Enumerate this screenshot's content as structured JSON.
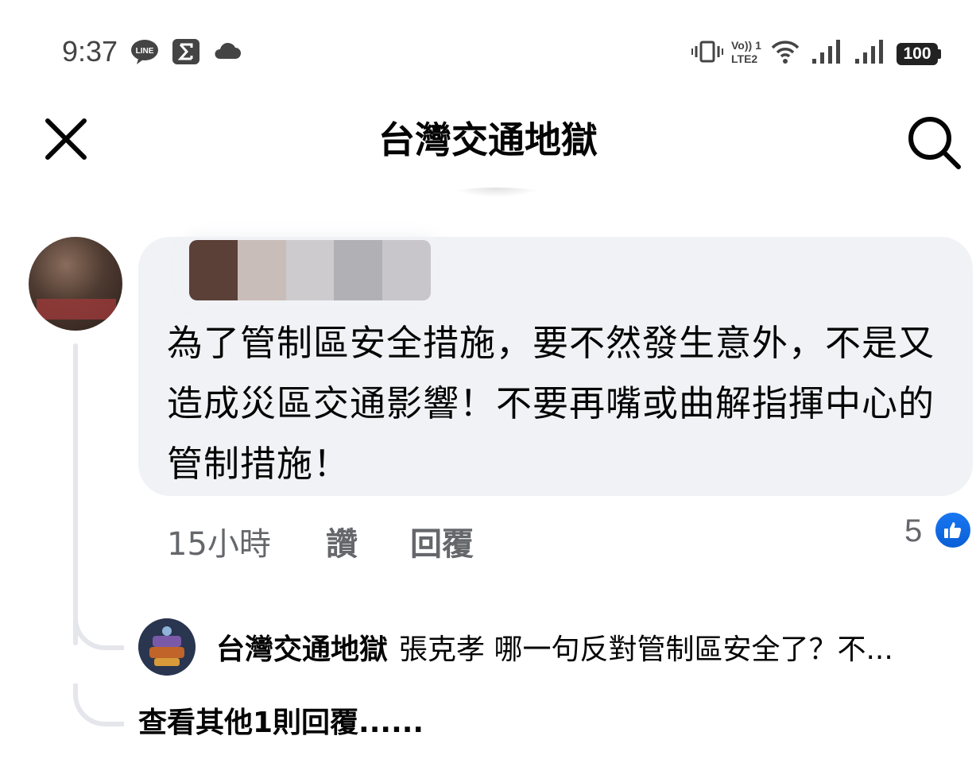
{
  "status_bar": {
    "time": "9:37",
    "left_icons": [
      "line-icon",
      "sigma-icon",
      "cloud-icon"
    ],
    "right_icons": [
      "vibrate-icon",
      "volte-lte2-icon",
      "wifi-icon",
      "signal-icon",
      "signal-icon"
    ],
    "volte_label": "Vo)) 1",
    "lte_label": "LTE2",
    "battery": "100"
  },
  "header": {
    "title": "台灣交通地獄",
    "close_icon": "close-icon",
    "search_icon": "search-icon"
  },
  "comment": {
    "text": "為了管制區安全措施，要不然發生意外，不是又造成災區交通影響！不要再嘴或曲解指揮中心的管制措施！",
    "time": "15小時",
    "like_label": "讚",
    "reply_label": "回覆",
    "reaction_count": "5",
    "reaction_icon": "thumbs-up-icon",
    "like_color": "#1877f2"
  },
  "reply": {
    "author": "台灣交通地獄",
    "text": "張克孝 哪一句反對管制區安全了？不..."
  },
  "more_replies": "查看其他1則回覆......"
}
